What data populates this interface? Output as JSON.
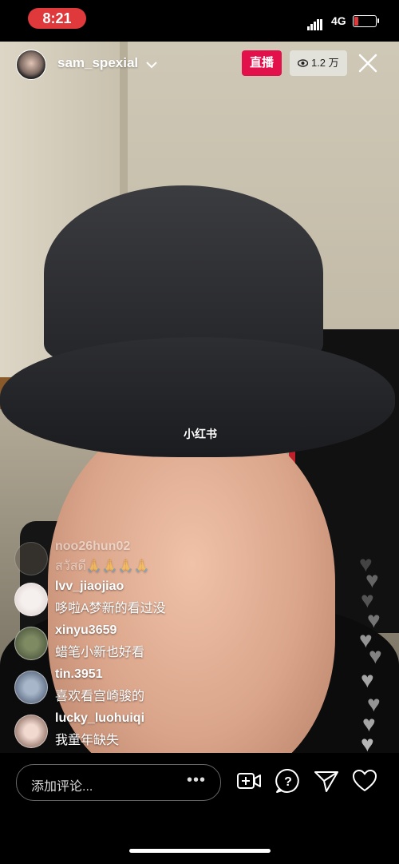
{
  "status_bar": {
    "time": "8:21",
    "network": "4G"
  },
  "header": {
    "host_name": "sam_spexial",
    "live_label": "直播",
    "viewer_count": "1.2 万",
    "icons": {
      "viewer": "eye-icon",
      "close": "close-icon",
      "dropdown": "chevron-down-icon"
    }
  },
  "watermark": "小红书",
  "comments": [
    {
      "user": "noo26hun02",
      "text": "สวัสดี🙏🙏🙏🙏",
      "faded": true
    },
    {
      "user": "lvv_jiaojiao",
      "text": "哆啦A梦新的看过没"
    },
    {
      "user": "xinyu3659",
      "text": "蜡笔小新也好看"
    },
    {
      "user": "tin.3951",
      "text": "喜欢看宫崎骏的"
    },
    {
      "user": "lucky_luohuiqi",
      "text": "我童年缺失"
    }
  ],
  "bottom_bar": {
    "comment_placeholder": "添加评论...",
    "more_label": "•••",
    "icons": [
      "add-video-icon",
      "question-icon",
      "send-icon",
      "heart-icon"
    ]
  },
  "colors": {
    "live": "#e2104b",
    "time_pill": "#e0393b",
    "battery_low": "#e0393b"
  }
}
